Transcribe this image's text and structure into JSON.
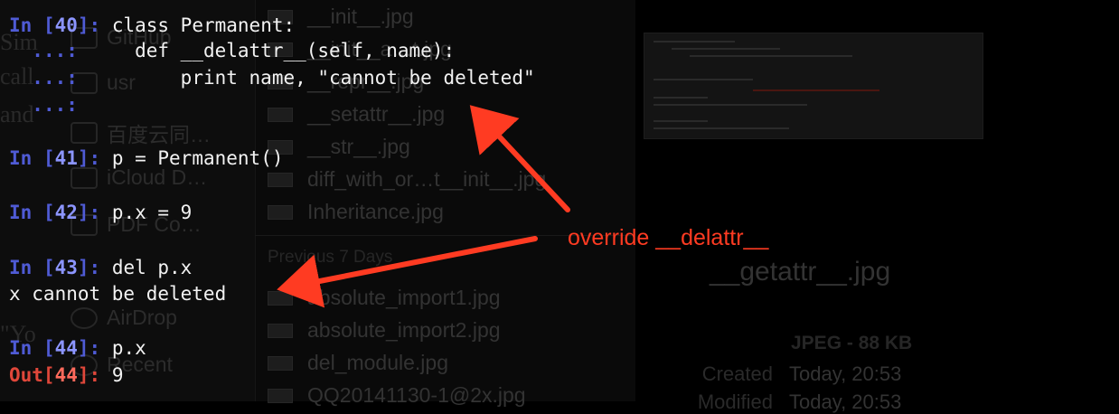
{
  "ghost_window": {
    "left_fragments": [
      "Sim",
      "call",
      "and",
      "\"Yo"
    ],
    "sidebar_items": [
      "GitHub",
      "usr",
      "百度云同…",
      "iCloud D…",
      "PDF Co…",
      "AirDrop",
      "Recent"
    ],
    "files": [
      "__init__.jpg",
      "__init__a…t.jpg",
      "__repr__.jpg",
      "__setattr__.jpg",
      "__str__.jpg",
      "diff_with_or…t__init__.jpg",
      "Inheritance.jpg"
    ],
    "section_header": "Previous 7 Days",
    "files_previous": [
      "absolute_import1.jpg",
      "absolute_import2.jpg",
      "del_module.jpg",
      "QQ20141130-1@2x.jpg"
    ],
    "preview": {
      "title": "__getattr__.jpg",
      "meta": "JPEG - 88 KB",
      "rows": [
        {
          "key": "Created",
          "value": "Today, 20:53"
        },
        {
          "key": "Modified",
          "value": "Today, 20:53"
        }
      ]
    }
  },
  "terminal": {
    "cells": [
      {
        "prompt": "In [",
        "num": "40",
        "end": "]:",
        "code": "class Permanent:"
      },
      {
        "cont": "...:",
        "code": "    def __delattr__(self, name):"
      },
      {
        "cont": "...:",
        "code": "        print name, \"cannot be deleted\""
      },
      {
        "cont": "...:",
        "code": ""
      },
      {
        "prompt": "In [",
        "num": "41",
        "end": "]:",
        "code": "p = Permanent()"
      },
      {
        "prompt": "In [",
        "num": "42",
        "end": "]:",
        "code": "p.x = 9"
      },
      {
        "prompt": "In [",
        "num": "43",
        "end": "]:",
        "code": "del p.x"
      },
      {
        "output": "x cannot be deleted"
      },
      {
        "prompt": "In [",
        "num": "44",
        "end": "]:",
        "code": "p.x"
      },
      {
        "out_prompt": "Out[",
        "num": "44",
        "end": "]:",
        "code": "9"
      }
    ]
  },
  "annotation": {
    "text": "override __delattr__",
    "color": "#ff3b22"
  },
  "colors": {
    "background": "#000000",
    "prompt_in": "#4f5bd5",
    "prompt_out": "#e0473a",
    "text": "#f2f2f2"
  }
}
